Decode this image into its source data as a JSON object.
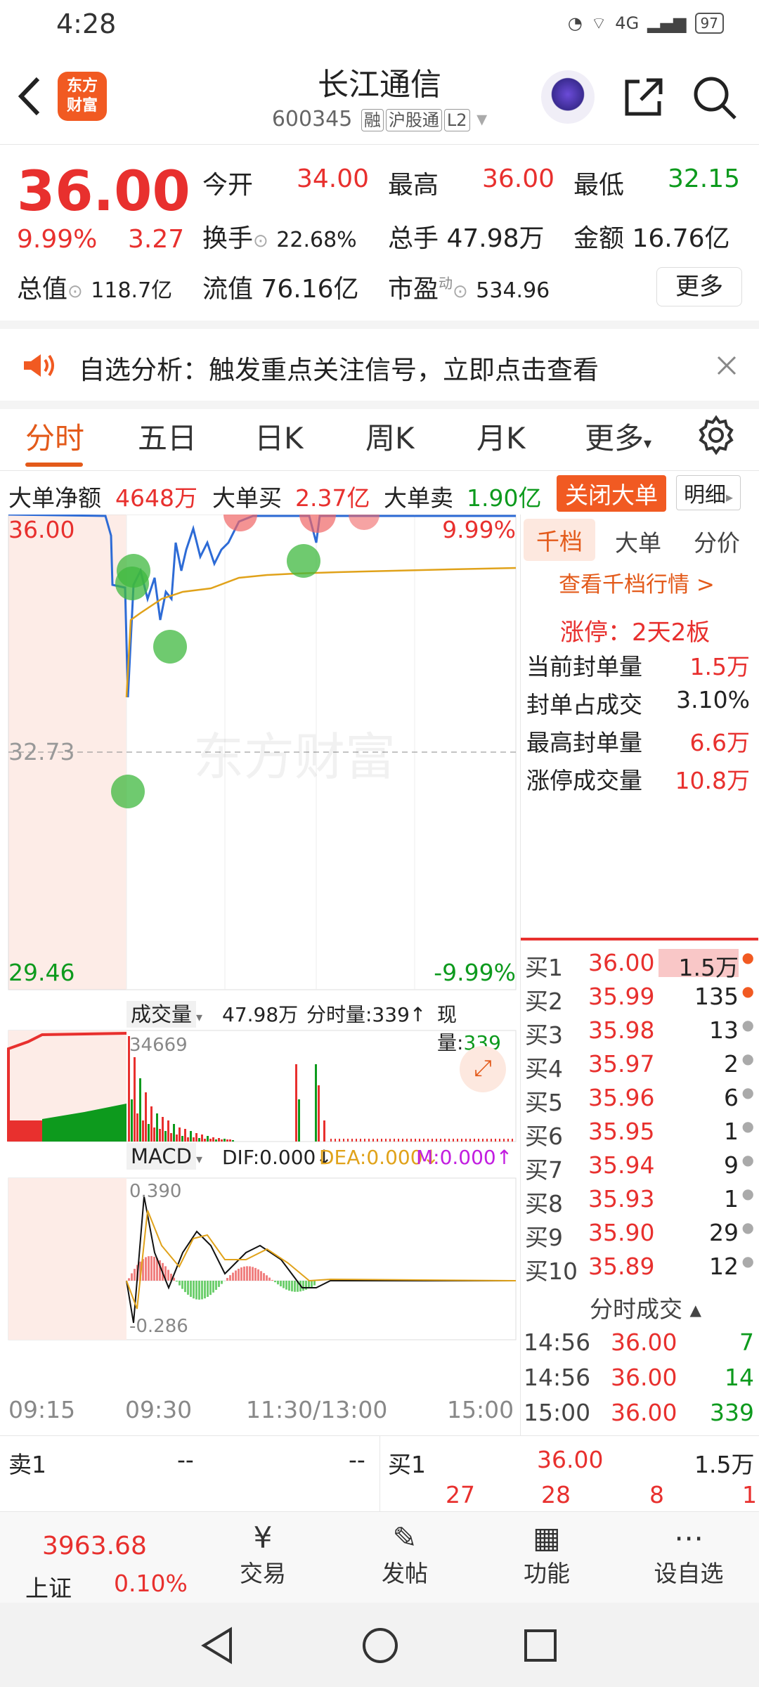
{
  "status": {
    "time": "4:28",
    "battery": "97",
    "net": "4G"
  },
  "header": {
    "stock_name": "长江通信",
    "code": "600345",
    "tags": [
      "融",
      "沪股通",
      "L2"
    ],
    "logo": "东方\n财富"
  },
  "quote": {
    "price": "36.00",
    "pct": "9.99%",
    "chg": "3.27",
    "open_label": "今开",
    "open": "34.00",
    "high_label": "最高",
    "high": "36.00",
    "low_label": "最低",
    "low": "32.15",
    "turnover_label": "换手",
    "turnover": "22.68%",
    "vol_label": "总手",
    "vol": "47.98万",
    "amt_label": "金额",
    "amt": "16.76亿",
    "mcap_label": "总值",
    "mcap": "118.7亿",
    "float_label": "流值",
    "float": "76.16亿",
    "pe_label": "市盈",
    "pe_sup": "动",
    "pe": "534.96",
    "more": "更多"
  },
  "notice": {
    "text": "自选分析：触发重点关注信号，立即点击查看"
  },
  "tabs": [
    "分时",
    "五日",
    "日K",
    "周K",
    "月K",
    "更多"
  ],
  "bigorder": {
    "net_label": "大单净额",
    "net": "4648万",
    "buy_label": "大单买",
    "buy": "2.37亿",
    "sell_label": "大单卖",
    "sell": "1.90亿",
    "close_btn": "关闭大单",
    "detail_btn": "明细"
  },
  "chart": {
    "price_top": "36.00",
    "price_mid": "32.73",
    "price_bot": "29.46",
    "pct_top": "9.99%",
    "pct_bot": "-9.99%",
    "vol_label": "成交量",
    "vol_total": "47.98万",
    "vol_min_label": "分时量:339",
    "vol_now_label": "现量:",
    "vol_now": "339",
    "vol_max": "34669",
    "macd_label": "MACD",
    "dif": "DIF:0.000",
    "dea": "DEA:0.000",
    "m": "M:0.000",
    "macd_top": "0.390",
    "macd_bot": "-0.286",
    "times": [
      "09:15",
      "09:30",
      "11:30/13:00",
      "15:00"
    ],
    "watermark": "东方财富"
  },
  "right": {
    "tabs": [
      "千档",
      "大单",
      "分价"
    ],
    "link": "查看千档行情 >",
    "limit_up": "涨停：2天2板",
    "stats": [
      {
        "label": "当前封单量",
        "value": "1.5万"
      },
      {
        "label": "封单占成交",
        "value": "3.10%"
      },
      {
        "label": "最高封单量",
        "value": "6.6万"
      },
      {
        "label": "涨停成交量",
        "value": "10.8万"
      }
    ],
    "bids": [
      {
        "l": "买1",
        "p": "36.00",
        "q": "1.5万"
      },
      {
        "l": "买2",
        "p": "35.99",
        "q": "135"
      },
      {
        "l": "买3",
        "p": "35.98",
        "q": "13"
      },
      {
        "l": "买4",
        "p": "35.97",
        "q": "2"
      },
      {
        "l": "买5",
        "p": "35.96",
        "q": "6"
      },
      {
        "l": "买6",
        "p": "35.95",
        "q": "1"
      },
      {
        "l": "买7",
        "p": "35.94",
        "q": "9"
      },
      {
        "l": "买8",
        "p": "35.93",
        "q": "1"
      },
      {
        "l": "买9",
        "p": "35.90",
        "q": "29"
      },
      {
        "l": "买10",
        "p": "35.89",
        "q": "12"
      }
    ],
    "ticks_label": "分时成交",
    "ticks": [
      {
        "t": "14:56",
        "p": "36.00",
        "v": "7"
      },
      {
        "t": "14:56",
        "p": "36.00",
        "v": "14"
      },
      {
        "t": "15:00",
        "p": "36.00",
        "v": "339"
      }
    ]
  },
  "book": {
    "sell1_label": "卖1",
    "sell1_p": "--",
    "sell1_q": "--",
    "buy1_label": "买1",
    "buy1_p": "36.00",
    "buy1_q": "1.5万",
    "sub": [
      "27",
      "28",
      "8",
      "1"
    ]
  },
  "bottom": {
    "index_val": "3963.68",
    "index_name": "上证",
    "index_pct": "0.10%",
    "items": [
      "交易",
      "发帖",
      "功能",
      "设自选"
    ]
  }
}
